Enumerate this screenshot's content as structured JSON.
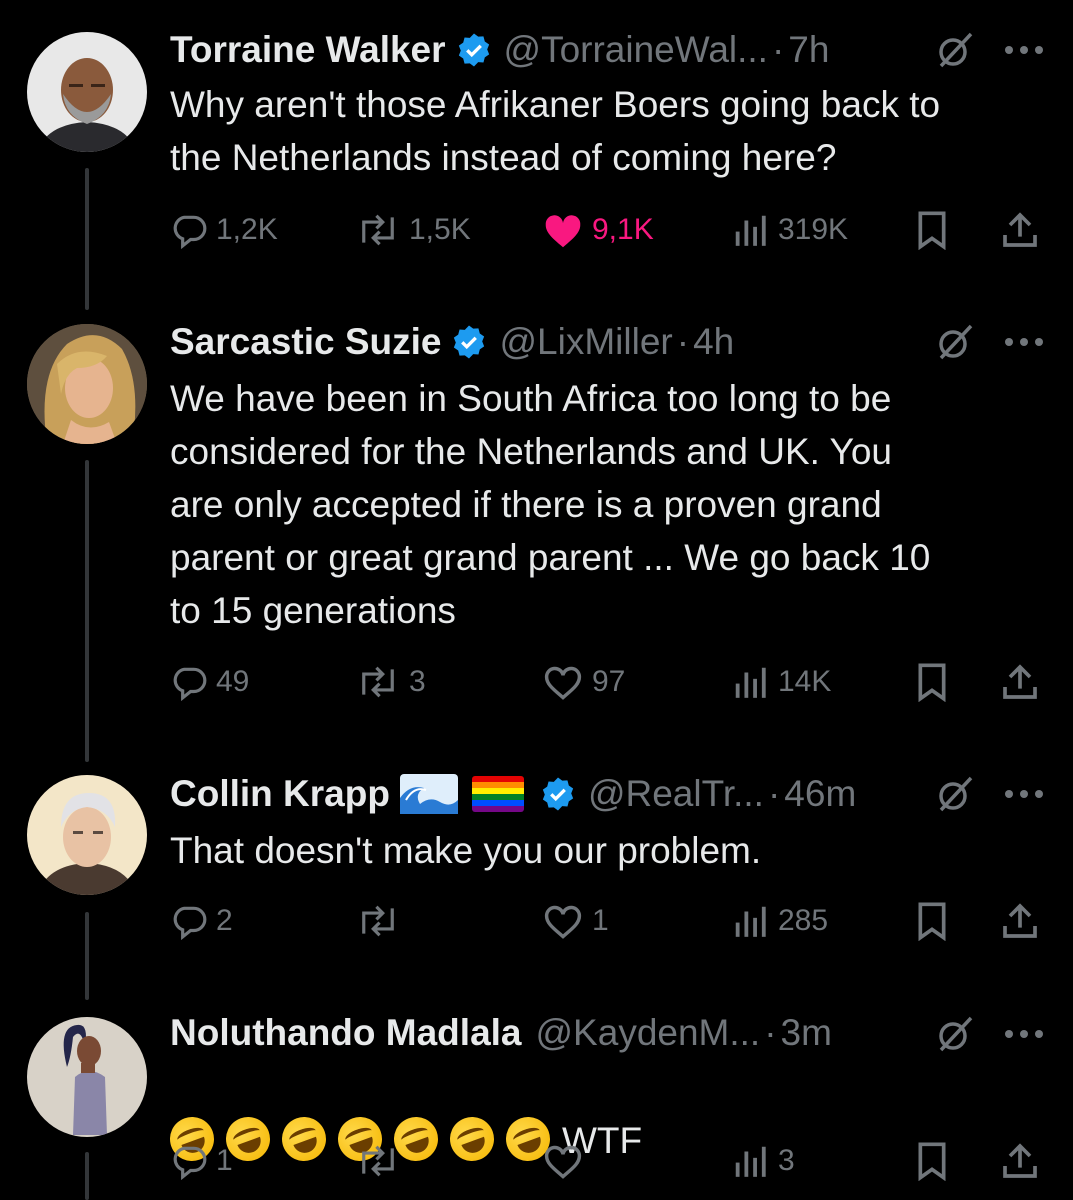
{
  "tweets": [
    {
      "name": "Torraine Walker",
      "handle": "@TorraineWal...",
      "dot": "·",
      "time": "7h",
      "text": "Why aren't those Afrikaner Boers going back to\nthe Netherlands instead of coming here?",
      "replies": "1,2K",
      "retweets": "1,5K",
      "likes": "9,1K",
      "liked": true,
      "views": "319K"
    },
    {
      "name": "Sarcastic Suzie",
      "handle": "@LixMiller",
      "dot": "·",
      "time": "4h",
      "text": "We have been in South Africa too long to be\nconsidered for the Netherlands and UK.  You\nare only accepted if there is a proven grand\nparent or great grand parent ...  We go back 10\nto 15 generations",
      "replies": "49",
      "retweets": "3",
      "likes": "97",
      "liked": false,
      "views": "14K"
    },
    {
      "name": "Collin Krapp",
      "handle": "@RealTr...",
      "dot": "·",
      "time": "46m",
      "text": "That doesn't make you our problem.",
      "replies": "2",
      "retweets": "",
      "likes": "1",
      "liked": false,
      "views": "285"
    },
    {
      "name": "Noluthando Madlala",
      "handle": "@KaydenM...",
      "dot": "·",
      "time": "3m",
      "text": "WTF",
      "emoji_count": 7,
      "replies": "1",
      "retweets": "",
      "likes": "",
      "liked": false,
      "views": "3"
    }
  ],
  "colors": {
    "background": "#000000",
    "text": "#e7e9ea",
    "muted": "#71767b",
    "verified": "#1d9bf0",
    "like": "#f91880"
  },
  "icons": [
    "reply-icon",
    "retweet-icon",
    "like-icon",
    "views-icon",
    "bookmark-icon",
    "share-icon",
    "grok-icon",
    "more-icon",
    "verified-badge-icon"
  ]
}
